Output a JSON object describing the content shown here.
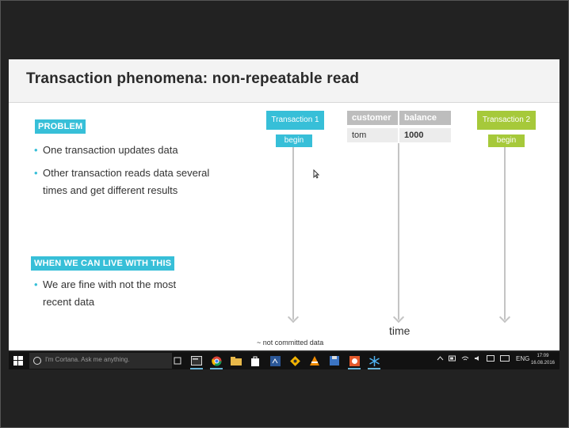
{
  "slide": {
    "title": "Transaction phenomena: non-repeatable read",
    "problem_tag": "PROBLEM",
    "problem_bullets": [
      "One transaction updates data",
      "Other transaction reads data several",
      "times and get different results"
    ],
    "live_tag": "WHEN WE CAN LIVE WITH THIS",
    "live_bullets": [
      "We are fine with not the most",
      "recent data"
    ],
    "transaction1": {
      "label": "Transaction 1",
      "action": "begin"
    },
    "transaction2": {
      "label": "Transaction 2",
      "action": "begin"
    },
    "table": {
      "headers": [
        "customer",
        "balance"
      ],
      "rows": [
        [
          "tom",
          "1000"
        ]
      ]
    },
    "time_label": "time",
    "footnote": "~ not committed data"
  },
  "taskbar": {
    "search_placeholder": "I'm Cortana. Ask me anything.",
    "language": "ENG",
    "time": "17:09",
    "date": "16.08.2016",
    "apps": [
      "task-view-icon",
      "terminal-icon",
      "chrome-icon",
      "file-explorer-icon",
      "store-icon",
      "app-blue-icon",
      "git-icon",
      "vlc-icon",
      "save-icon",
      "paint-icon",
      "snowflake-icon"
    ]
  },
  "colors": {
    "accent_cyan": "#37bfd8",
    "accent_green": "#a6c93a",
    "table_header": "#bdbdbd"
  }
}
